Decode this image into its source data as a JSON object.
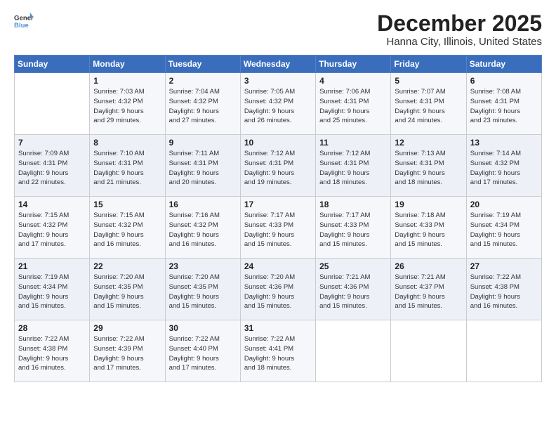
{
  "logo": {
    "general": "General",
    "blue": "Blue"
  },
  "title": "December 2025",
  "subtitle": "Hanna City, Illinois, United States",
  "weekdays": [
    "Sunday",
    "Monday",
    "Tuesday",
    "Wednesday",
    "Thursday",
    "Friday",
    "Saturday"
  ],
  "weeks": [
    [
      {
        "day": "",
        "info": ""
      },
      {
        "day": "1",
        "info": "Sunrise: 7:03 AM\nSunset: 4:32 PM\nDaylight: 9 hours\nand 29 minutes."
      },
      {
        "day": "2",
        "info": "Sunrise: 7:04 AM\nSunset: 4:32 PM\nDaylight: 9 hours\nand 27 minutes."
      },
      {
        "day": "3",
        "info": "Sunrise: 7:05 AM\nSunset: 4:32 PM\nDaylight: 9 hours\nand 26 minutes."
      },
      {
        "day": "4",
        "info": "Sunrise: 7:06 AM\nSunset: 4:31 PM\nDaylight: 9 hours\nand 25 minutes."
      },
      {
        "day": "5",
        "info": "Sunrise: 7:07 AM\nSunset: 4:31 PM\nDaylight: 9 hours\nand 24 minutes."
      },
      {
        "day": "6",
        "info": "Sunrise: 7:08 AM\nSunset: 4:31 PM\nDaylight: 9 hours\nand 23 minutes."
      }
    ],
    [
      {
        "day": "7",
        "info": "Sunrise: 7:09 AM\nSunset: 4:31 PM\nDaylight: 9 hours\nand 22 minutes."
      },
      {
        "day": "8",
        "info": "Sunrise: 7:10 AM\nSunset: 4:31 PM\nDaylight: 9 hours\nand 21 minutes."
      },
      {
        "day": "9",
        "info": "Sunrise: 7:11 AM\nSunset: 4:31 PM\nDaylight: 9 hours\nand 20 minutes."
      },
      {
        "day": "10",
        "info": "Sunrise: 7:12 AM\nSunset: 4:31 PM\nDaylight: 9 hours\nand 19 minutes."
      },
      {
        "day": "11",
        "info": "Sunrise: 7:12 AM\nSunset: 4:31 PM\nDaylight: 9 hours\nand 18 minutes."
      },
      {
        "day": "12",
        "info": "Sunrise: 7:13 AM\nSunset: 4:31 PM\nDaylight: 9 hours\nand 18 minutes."
      },
      {
        "day": "13",
        "info": "Sunrise: 7:14 AM\nSunset: 4:32 PM\nDaylight: 9 hours\nand 17 minutes."
      }
    ],
    [
      {
        "day": "14",
        "info": "Sunrise: 7:15 AM\nSunset: 4:32 PM\nDaylight: 9 hours\nand 17 minutes."
      },
      {
        "day": "15",
        "info": "Sunrise: 7:15 AM\nSunset: 4:32 PM\nDaylight: 9 hours\nand 16 minutes."
      },
      {
        "day": "16",
        "info": "Sunrise: 7:16 AM\nSunset: 4:32 PM\nDaylight: 9 hours\nand 16 minutes."
      },
      {
        "day": "17",
        "info": "Sunrise: 7:17 AM\nSunset: 4:33 PM\nDaylight: 9 hours\nand 15 minutes."
      },
      {
        "day": "18",
        "info": "Sunrise: 7:17 AM\nSunset: 4:33 PM\nDaylight: 9 hours\nand 15 minutes."
      },
      {
        "day": "19",
        "info": "Sunrise: 7:18 AM\nSunset: 4:33 PM\nDaylight: 9 hours\nand 15 minutes."
      },
      {
        "day": "20",
        "info": "Sunrise: 7:19 AM\nSunset: 4:34 PM\nDaylight: 9 hours\nand 15 minutes."
      }
    ],
    [
      {
        "day": "21",
        "info": "Sunrise: 7:19 AM\nSunset: 4:34 PM\nDaylight: 9 hours\nand 15 minutes."
      },
      {
        "day": "22",
        "info": "Sunrise: 7:20 AM\nSunset: 4:35 PM\nDaylight: 9 hours\nand 15 minutes."
      },
      {
        "day": "23",
        "info": "Sunrise: 7:20 AM\nSunset: 4:35 PM\nDaylight: 9 hours\nand 15 minutes."
      },
      {
        "day": "24",
        "info": "Sunrise: 7:20 AM\nSunset: 4:36 PM\nDaylight: 9 hours\nand 15 minutes."
      },
      {
        "day": "25",
        "info": "Sunrise: 7:21 AM\nSunset: 4:36 PM\nDaylight: 9 hours\nand 15 minutes."
      },
      {
        "day": "26",
        "info": "Sunrise: 7:21 AM\nSunset: 4:37 PM\nDaylight: 9 hours\nand 15 minutes."
      },
      {
        "day": "27",
        "info": "Sunrise: 7:22 AM\nSunset: 4:38 PM\nDaylight: 9 hours\nand 16 minutes."
      }
    ],
    [
      {
        "day": "28",
        "info": "Sunrise: 7:22 AM\nSunset: 4:38 PM\nDaylight: 9 hours\nand 16 minutes."
      },
      {
        "day": "29",
        "info": "Sunrise: 7:22 AM\nSunset: 4:39 PM\nDaylight: 9 hours\nand 17 minutes."
      },
      {
        "day": "30",
        "info": "Sunrise: 7:22 AM\nSunset: 4:40 PM\nDaylight: 9 hours\nand 17 minutes."
      },
      {
        "day": "31",
        "info": "Sunrise: 7:22 AM\nSunset: 4:41 PM\nDaylight: 9 hours\nand 18 minutes."
      },
      {
        "day": "",
        "info": ""
      },
      {
        "day": "",
        "info": ""
      },
      {
        "day": "",
        "info": ""
      }
    ]
  ]
}
